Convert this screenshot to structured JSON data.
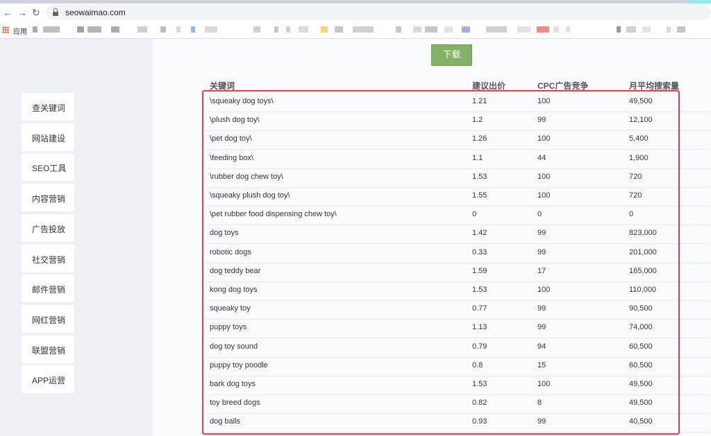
{
  "browser": {
    "url": "seowaimao.com",
    "bookmarks_label": "应用",
    "nav": {
      "back": "←",
      "forward": "→",
      "reload": "↻"
    }
  },
  "sidebar": {
    "items": [
      {
        "label": "查关键词"
      },
      {
        "label": "网站建设"
      },
      {
        "label": "SEO工具"
      },
      {
        "label": "内容营销"
      },
      {
        "label": "广告投放"
      },
      {
        "label": "社交营销"
      },
      {
        "label": "邮件营销"
      },
      {
        "label": "网红营销"
      },
      {
        "label": "联盟营销"
      },
      {
        "label": "APP运营"
      }
    ]
  },
  "toolbar": {
    "download_label": "下载"
  },
  "table": {
    "headers": [
      "关键词",
      "建议出价",
      "CPC广告竞争",
      "月平均搜索量"
    ],
    "rows": [
      [
        "\\squeaky dog toys\\",
        "1.21",
        "100",
        "49,500"
      ],
      [
        "\\plush dog toy\\",
        "1.2",
        "99",
        "12,100"
      ],
      [
        "\\pet dog toy\\",
        "1.26",
        "100",
        "5,400"
      ],
      [
        "\\feeding box\\",
        "1.1",
        "44",
        "1,900"
      ],
      [
        "\\rubber dog chew toy\\",
        "1.53",
        "100",
        "720"
      ],
      [
        "\\squeaky plush dog toy\\",
        "1.55",
        "100",
        "720"
      ],
      [
        "\\pet rubber food dispensing chew toy\\",
        "0",
        "0",
        "0"
      ],
      [
        "dog toys",
        "1.42",
        "99",
        "823,000"
      ],
      [
        "robotic dogs",
        "0.33",
        "99",
        "201,000"
      ],
      [
        "dog teddy bear",
        "1.59",
        "17",
        "165,000"
      ],
      [
        "kong dog toys",
        "1.53",
        "100",
        "110,000"
      ],
      [
        "squeaky toy",
        "0.77",
        "99",
        "90,500"
      ],
      [
        "puppy toys",
        "1.13",
        "99",
        "74,000"
      ],
      [
        "dog toy sound",
        "0.79",
        "94",
        "60,500"
      ],
      [
        "puppy toy poodle",
        "0.8",
        "15",
        "60,500"
      ],
      [
        "bark dog toys",
        "1.53",
        "100",
        "49,500"
      ],
      [
        "toy breed dogs",
        "0.82",
        "8",
        "49,500"
      ],
      [
        "dog balls",
        "0.93",
        "99",
        "40,500"
      ]
    ]
  },
  "colors": {
    "highlight": "#e53a4b",
    "download_button": "#85b067"
  }
}
